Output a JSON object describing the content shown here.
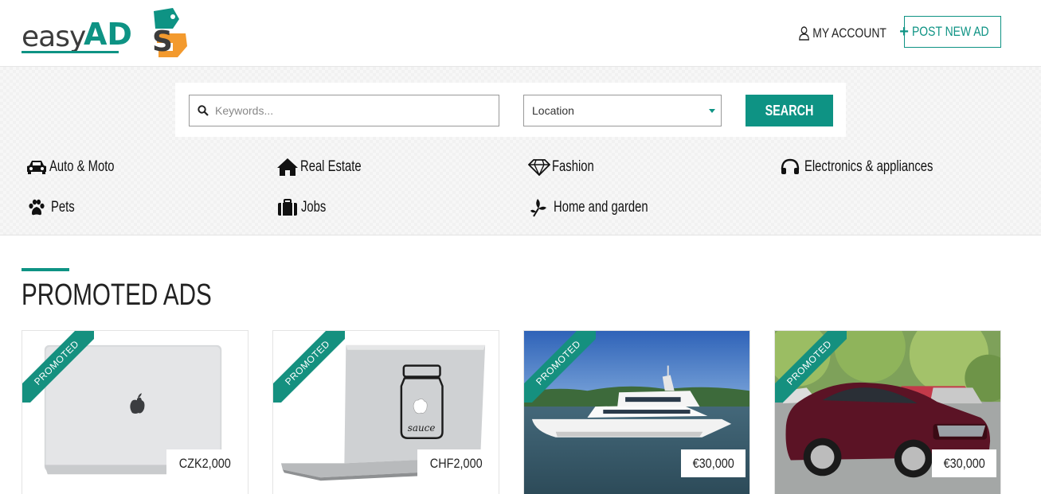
{
  "header": {
    "logo_text": "easyADS",
    "my_account": "MY ACCOUNT",
    "post_ad": "POST NEW AD"
  },
  "search": {
    "keywords_placeholder": "Keywords...",
    "location_value": "Location",
    "button": "SEARCH"
  },
  "categories": [
    {
      "label": "Auto & Moto",
      "icon": "car-icon"
    },
    {
      "label": "Real Estate",
      "icon": "home-icon"
    },
    {
      "label": "Fashion",
      "icon": "diamond-icon"
    },
    {
      "label": "Electronics & appliances",
      "icon": "headphones-icon"
    },
    {
      "label": "Pets",
      "icon": "paw-icon"
    },
    {
      "label": "Jobs",
      "icon": "briefcase-icon"
    },
    {
      "label": "Home and garden",
      "icon": "plant-icon"
    }
  ],
  "promoted": {
    "title": "PROMOTED ADS",
    "badge": "PROMOTED",
    "ads": [
      {
        "price": "CZK2,000"
      },
      {
        "price": "CHF2,000"
      },
      {
        "price": "€30,000"
      },
      {
        "price": "€30,000"
      }
    ]
  },
  "colors": {
    "accent": "#0e9384",
    "logo_orange": "#f39a2e"
  }
}
